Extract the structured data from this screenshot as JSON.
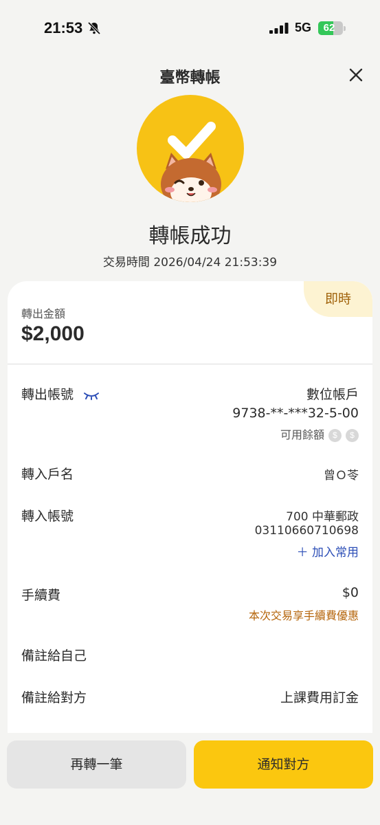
{
  "status_bar": {
    "time": "21:53",
    "network": "5G",
    "battery": "62",
    "battery_fraction": 0.62
  },
  "header": {
    "title": "臺幣轉帳"
  },
  "result": {
    "title": "轉帳成功",
    "timestamp": "交易時間 2026/04/24 21:53:39"
  },
  "card": {
    "badge": "即時",
    "amount_label": "轉出金額",
    "amount": "$2,000",
    "rows": {
      "from_account": {
        "label": "轉出帳號",
        "type": "數位帳戶",
        "number": "9738-**-***32-5-00",
        "balance_label": "可用餘額"
      },
      "payee_name": {
        "label": "轉入戶名",
        "value": "曾Ｏ苓"
      },
      "to_account": {
        "label": "轉入帳號",
        "bank": "700 中華郵政",
        "number": "03110660710698",
        "add_favorite": "加入常用"
      },
      "fee": {
        "label": "手續費",
        "value": "$0",
        "note": "本次交易享手續費優惠"
      },
      "memo_self": {
        "label": "備註給自己",
        "value": ""
      },
      "memo_payee": {
        "label": "備註給對方",
        "value": "上課費用訂金"
      }
    }
  },
  "actions": {
    "again": "再轉一筆",
    "notify": "通知對方"
  },
  "colors": {
    "brand_yellow": "#f7c215",
    "link_blue": "#2d4fb7",
    "discount_orange": "#b5650b"
  }
}
